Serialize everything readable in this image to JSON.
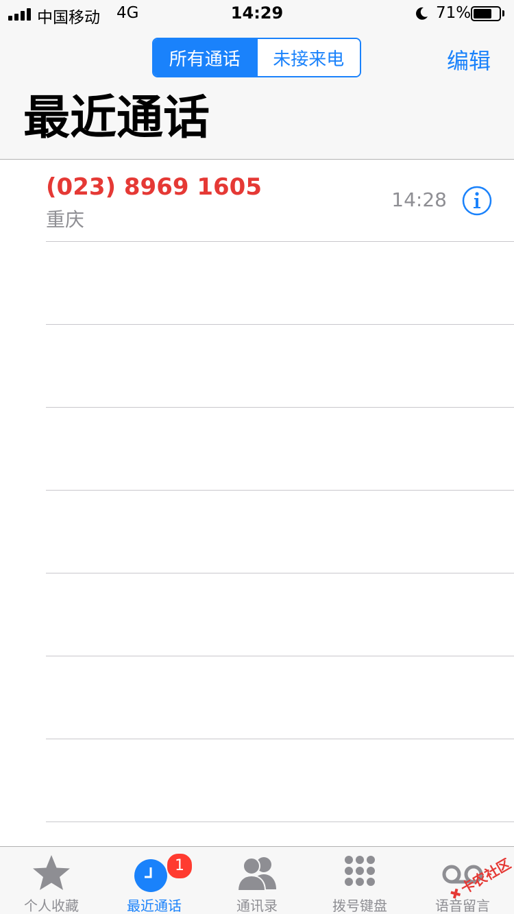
{
  "status_bar": {
    "carrier": "中国移动",
    "network": "4G",
    "time": "14:29",
    "battery_percent": "71%",
    "battery_level": 0.71,
    "icons": [
      "signal-icon",
      "moon-icon",
      "battery-icon"
    ]
  },
  "nav": {
    "segments": [
      {
        "label": "所有通话",
        "selected": true
      },
      {
        "label": "未接来电",
        "selected": false
      }
    ],
    "edit_label": "编辑"
  },
  "page_title": "最近通话",
  "calls": [
    {
      "number": "(023) 8969 1605",
      "location": "重庆",
      "time": "14:28",
      "missed": true
    }
  ],
  "tab_bar": {
    "tabs": [
      {
        "label": "个人收藏",
        "icon": "star-icon",
        "active": false
      },
      {
        "label": "最近通话",
        "icon": "clock-icon",
        "active": true,
        "badge": "1"
      },
      {
        "label": "通讯录",
        "icon": "contacts-icon",
        "active": false
      },
      {
        "label": "拨号键盘",
        "icon": "keypad-icon",
        "active": false
      },
      {
        "label": "语音留言",
        "icon": "voicemail-icon",
        "active": false
      }
    ]
  },
  "colors": {
    "accent": "#1a82fb",
    "missed": "#e53935",
    "badge": "#ff3b30",
    "secondary_text": "#8e8e93"
  },
  "watermark": {
    "text": "卡农社区"
  }
}
